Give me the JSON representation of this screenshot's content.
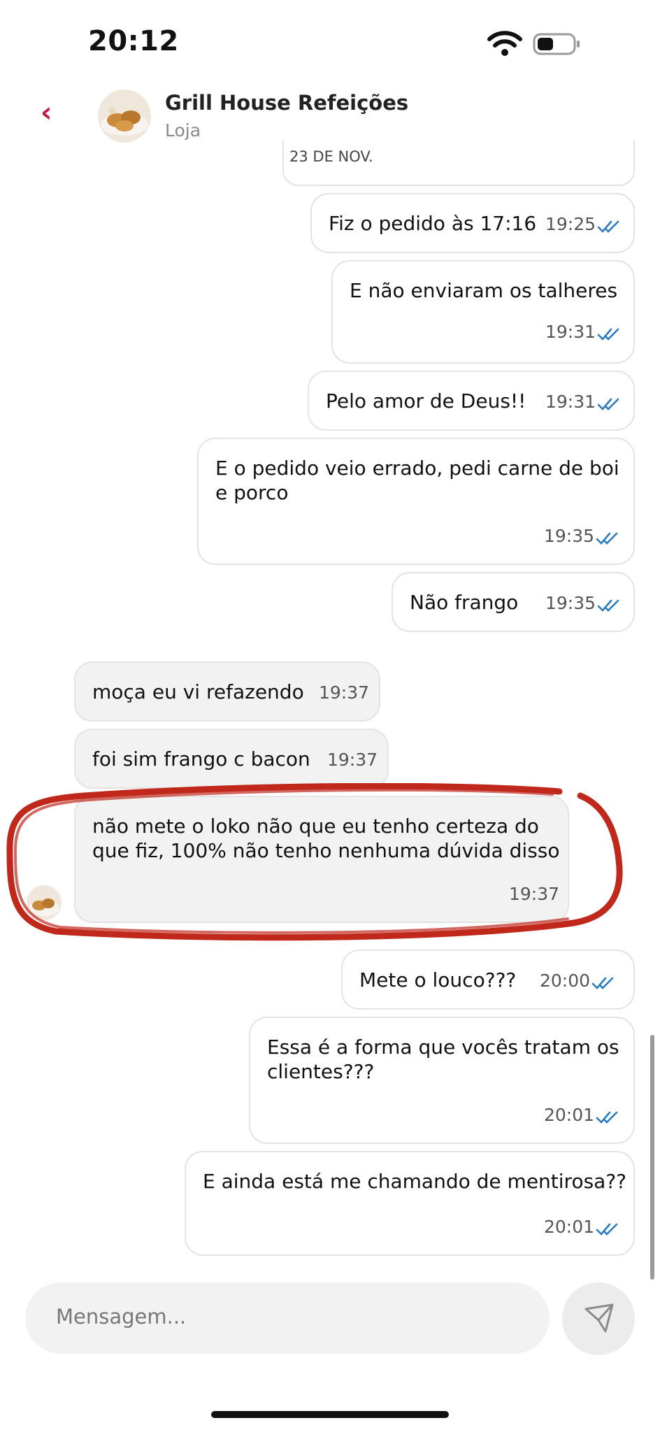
{
  "status": {
    "time": "20:12"
  },
  "header": {
    "title": "Grill House Refeições",
    "subtitle": "Loja"
  },
  "date_separator": "23 DE NOV.",
  "messages": [
    {
      "direction": "out",
      "lines": [
        "Fiz o pedido às 17:16"
      ],
      "time": "19:25"
    },
    {
      "direction": "out",
      "lines": [
        "E não enviaram os talheres"
      ],
      "time": "19:31"
    },
    {
      "direction": "out",
      "lines": [
        "Pelo amor de Deus!!"
      ],
      "time": "19:31"
    },
    {
      "direction": "out",
      "lines": [
        "E o pedido veio errado, pedi carne de boi",
        "e porco"
      ],
      "time": "19:35"
    },
    {
      "direction": "out",
      "lines": [
        "Não frango"
      ],
      "time": "19:35"
    },
    {
      "direction": "in",
      "lines": [
        "moça eu vi refazendo"
      ],
      "time": "19:37"
    },
    {
      "direction": "in",
      "lines": [
        "foi sim frango c bacon"
      ],
      "time": "19:37"
    },
    {
      "direction": "in",
      "lines": [
        "não mete o loko não que eu tenho certeza do",
        "que fiz, 100% não tenho nenhuma dúvida disso"
      ],
      "time": "19:37"
    },
    {
      "direction": "out",
      "lines": [
        "Mete o louco???"
      ],
      "time": "20:00"
    },
    {
      "direction": "out",
      "lines": [
        "Essa é a forma que vocês tratam os",
        "clientes???"
      ],
      "time": "20:01"
    },
    {
      "direction": "out",
      "lines": [
        "E ainda está me chamando de mentirosa??"
      ],
      "time": "20:01"
    }
  ],
  "composer": {
    "placeholder": "Mensagem..."
  },
  "icons": {
    "back": "chevron-left-icon",
    "send": "send-icon",
    "read_receipt": "double-check-icon",
    "wifi": "wifi-icon",
    "battery": "battery-icon"
  },
  "colors": {
    "accent": "#c2163b",
    "read_check": "#2a7bbf",
    "incoming_bubble": "#f2f2f2",
    "outgoing_bubble": "#ffffff",
    "annotation_circle": "#c0281c"
  }
}
